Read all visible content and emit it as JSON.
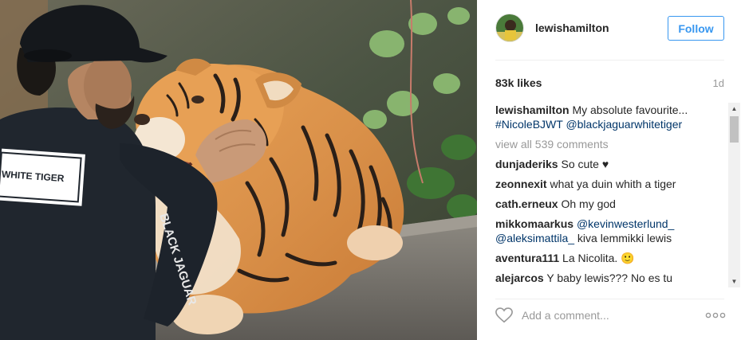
{
  "post": {
    "username": "lewishamilton",
    "follow_label": "Follow",
    "likes": "83k likes",
    "age": "1d",
    "caption": {
      "user": "lewishamilton",
      "text": " My absolute favourite...",
      "hashtag": "#NicoleBJWT",
      "mention": "@blackjaguarwhitetiger"
    },
    "view_all": "view all 539 comments",
    "comments": [
      {
        "user": "dunjaderiks",
        "text": " So cute ♥"
      },
      {
        "user": "zeonnexit",
        "text": " what ya duin whith a tiger"
      },
      {
        "user": "cath.erneux",
        "text": " Oh my god"
      },
      {
        "user": "mikkomaarkus",
        "mention1": "@kevinwesterlund_",
        "mention2": "@aleksimattila_",
        "text": " kiva lemmikki lewis"
      },
      {
        "user": "aventura111",
        "text": " La Nicolita. 🙂"
      },
      {
        "user": "alejarcos",
        "text": " Y baby lewis??? No es tu"
      }
    ],
    "shirt_text": "WHITE TIGER",
    "sleeve_text": "BLACK JAGUAR",
    "add_comment_placeholder": "Add a comment...",
    "accent_color": "#3897f0"
  },
  "icons": {
    "heart": "heart-outline-icon",
    "more": "more-options-icon",
    "scroll_up": "scroll-up-arrow-icon",
    "scroll_down": "scroll-down-arrow-icon"
  }
}
